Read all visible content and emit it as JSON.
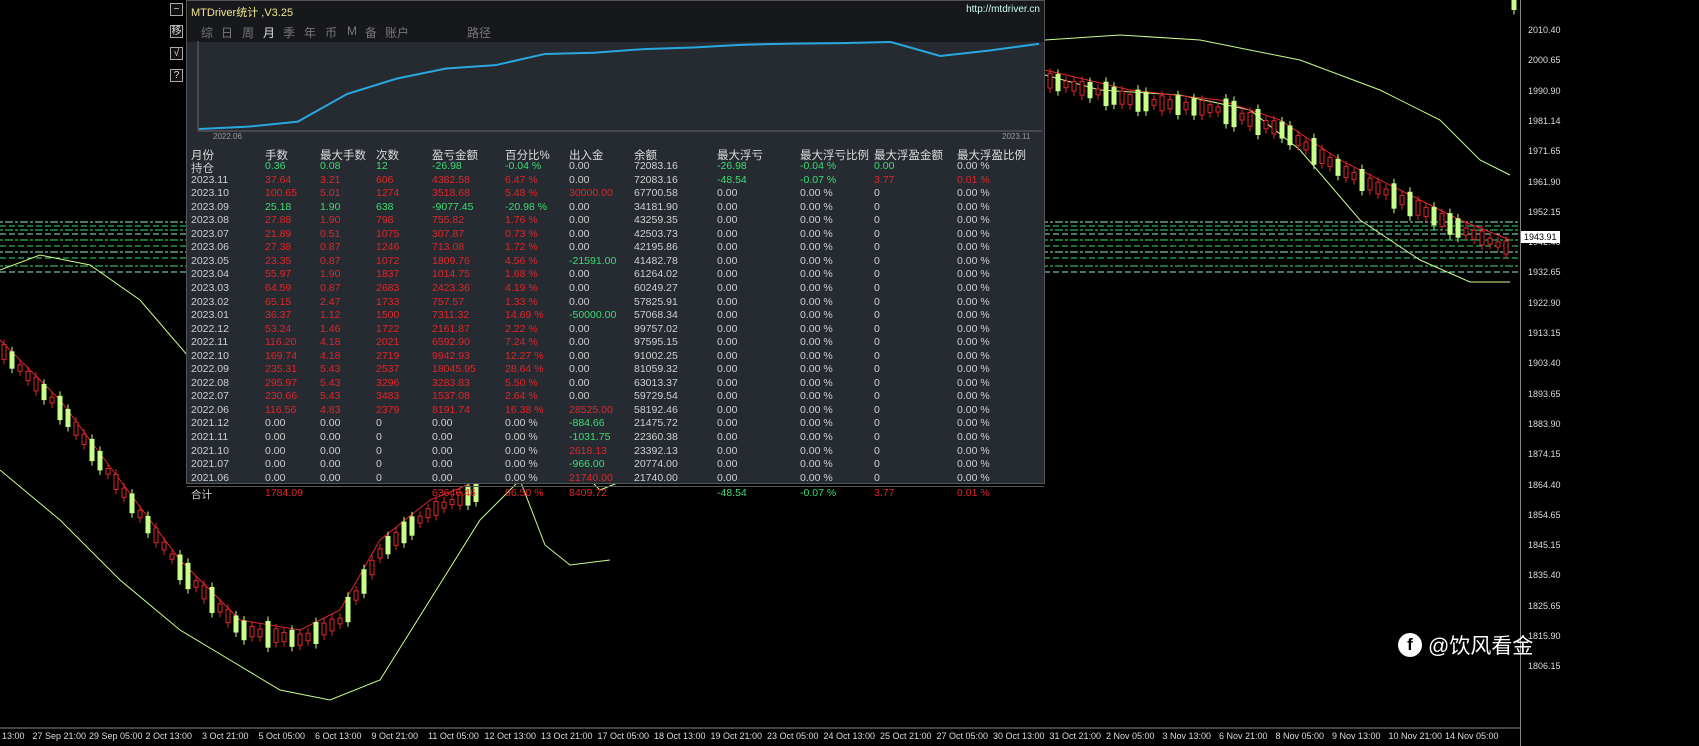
{
  "window": {
    "title": "MTDriver统计 ,V3.25",
    "url": "http://mtdriver.cn"
  },
  "side_buttons": [
    "−",
    "移",
    "√",
    "?"
  ],
  "tabs": [
    {
      "label": "综"
    },
    {
      "label": "日"
    },
    {
      "label": "周"
    },
    {
      "label": "月",
      "active": true
    },
    {
      "label": "季"
    },
    {
      "label": "年"
    },
    {
      "label": "币"
    },
    {
      "label": "M"
    },
    {
      "label": "备"
    },
    {
      "label": "账户"
    },
    {
      "label": "路径"
    }
  ],
  "chart_data": {
    "type": "line",
    "title": "",
    "x_start_label": "2022.06",
    "x_end_label": "2023.11",
    "series": [
      {
        "name": "equity",
        "color": "#29a8e0",
        "values": [
          8191.74,
          9728.82,
          13012.65,
          31058.6,
          41001.53,
          47594.43,
          49756.3,
          57067.62,
          57825.19,
          60248.55,
          61263.3,
          63073.06,
          63786.14,
          64094.01,
          64849.83,
          55772.38,
          59291.06,
          63673.64
        ]
      }
    ]
  },
  "table": {
    "headers": [
      "月份",
      "手数",
      "最大手数",
      "次数",
      "盈亏金额",
      "百分比%",
      "出入金",
      "余额",
      "最大浮亏",
      "最大浮亏比例",
      "最大浮盈金额",
      "最大浮盈比例"
    ],
    "rows": [
      {
        "c": "wgggggwwgggw",
        "v": [
          "持仓",
          "0.36",
          "0.08",
          "12",
          "-26.98",
          "-0.04 %",
          "0.00",
          "72083.16",
          "-26.98",
          "-0.04 %",
          "0.00",
          "0.00 %"
        ]
      },
      {
        "c": "wrrrrrwwggrr",
        "v": [
          "2023.11",
          "37.64",
          "3.21",
          "606",
          "4382.58",
          "6.47 %",
          "0.00",
          "72083.16",
          "-48.54",
          "-0.07 %",
          "3.77",
          "0.01 %"
        ]
      },
      {
        "c": "wrrrrrrwwwww",
        "v": [
          "2023.10",
          "100.65",
          "5.01",
          "1274",
          "3518.68",
          "5.48 %",
          "30000.00",
          "67700.58",
          "0.00",
          "0.00 %",
          "0",
          "0.00 %"
        ]
      },
      {
        "c": "wgggggwwwwww",
        "v": [
          "2023.09",
          "25.18",
          "1.90",
          "638",
          "-9077.45",
          "-20.98 %",
          "0.00",
          "34181.90",
          "0.00",
          "0.00 %",
          "0",
          "0.00 %"
        ]
      },
      {
        "c": "wrrrrrwwwwww",
        "v": [
          "2023.08",
          "27.88",
          "1.90",
          "798",
          "755.82",
          "1.76 %",
          "0.00",
          "43259.35",
          "0.00",
          "0.00 %",
          "0",
          "0.00 %"
        ]
      },
      {
        "c": "wrrrrrwwwwww",
        "v": [
          "2023.07",
          "21.89",
          "0.51",
          "1075",
          "307.87",
          "0.73 %",
          "0.00",
          "42503.73",
          "0.00",
          "0.00 %",
          "0",
          "0.00 %"
        ]
      },
      {
        "c": "wrrrrrwwwwww",
        "v": [
          "2023.06",
          "27.38",
          "0.87",
          "1246",
          "713.08",
          "1.72 %",
          "0.00",
          "42195.86",
          "0.00",
          "0.00 %",
          "0",
          "0.00 %"
        ]
      },
      {
        "c": "wrrrrrgwwwww",
        "v": [
          "2023.05",
          "23.35",
          "0.87",
          "1072",
          "1809.76",
          "4.56 %",
          "-21591.00",
          "41482.78",
          "0.00",
          "0.00 %",
          "0",
          "0.00 %"
        ]
      },
      {
        "c": "wrrrrrwwwwww",
        "v": [
          "2023.04",
          "55.97",
          "1.90",
          "1837",
          "1014.75",
          "1.68 %",
          "0.00",
          "61264.02",
          "0.00",
          "0.00 %",
          "0",
          "0.00 %"
        ]
      },
      {
        "c": "wrrrrrwwwwww",
        "v": [
          "2023.03",
          "64.59",
          "0.87",
          "2683",
          "2423.36",
          "4.19 %",
          "0.00",
          "60249.27",
          "0.00",
          "0.00 %",
          "0",
          "0.00 %"
        ]
      },
      {
        "c": "wrrrrrwwwwww",
        "v": [
          "2023.02",
          "65.15",
          "2.47",
          "1733",
          "757.57",
          "1.33 %",
          "0.00",
          "57825.91",
          "0.00",
          "0.00 %",
          "0",
          "0.00 %"
        ]
      },
      {
        "c": "wrrrrrgwwwww",
        "v": [
          "2023.01",
          "36.37",
          "1.12",
          "1500",
          "7311.32",
          "14.69 %",
          "-50000.00",
          "57068.34",
          "0.00",
          "0.00 %",
          "0",
          "0.00 %"
        ]
      },
      {
        "c": "wrrrrrwwwwww",
        "v": [
          "2022.12",
          "53.24",
          "1.46",
          "1722",
          "2161.87",
          "2.22 %",
          "0.00",
          "99757.02",
          "0.00",
          "0.00 %",
          "0",
          "0.00 %"
        ]
      },
      {
        "c": "wrrrrrwwwwww",
        "v": [
          "2022.11",
          "116.20",
          "4.18",
          "2021",
          "6592.90",
          "7.24 %",
          "0.00",
          "97595.15",
          "0.00",
          "0.00 %",
          "0",
          "0.00 %"
        ]
      },
      {
        "c": "wrrrrrwwwwww",
        "v": [
          "2022.10",
          "169.74",
          "4.18",
          "2719",
          "9942.93",
          "12.27 %",
          "0.00",
          "91002.25",
          "0.00",
          "0.00 %",
          "0",
          "0.00 %"
        ]
      },
      {
        "c": "wrrrrrwwwwww",
        "v": [
          "2022.09",
          "235.31",
          "5.43",
          "2537",
          "18045.95",
          "28.64 %",
          "0.00",
          "81059.32",
          "0.00",
          "0.00 %",
          "0",
          "0.00 %"
        ]
      },
      {
        "c": "wrrrrrwwwwww",
        "v": [
          "2022.08",
          "295.97",
          "5.43",
          "3296",
          "3283.83",
          "5.50 %",
          "0.00",
          "63013.37",
          "0.00",
          "0.00 %",
          "0",
          "0.00 %"
        ]
      },
      {
        "c": "wrrrrrwwwwww",
        "v": [
          "2022.07",
          "230.66",
          "5.43",
          "3483",
          "1537.08",
          "2.64 %",
          "0.00",
          "59729.54",
          "0.00",
          "0.00 %",
          "0",
          "0.00 %"
        ]
      },
      {
        "c": "wrrrrrrwwwww",
        "v": [
          "2022.06",
          "116.56",
          "4.83",
          "2379",
          "8191.74",
          "16.38 %",
          "28525.00",
          "58192.46",
          "0.00",
          "0.00 %",
          "0",
          "0.00 %"
        ]
      },
      {
        "c": "wwwwwwgwwwww",
        "v": [
          "2021.12",
          "0.00",
          "0.00",
          "0",
          "0.00",
          "0.00 %",
          "-884.66",
          "21475.72",
          "0.00",
          "0.00 %",
          "0",
          "0.00 %"
        ]
      },
      {
        "c": "wwwwwwgwwwww",
        "v": [
          "2021.11",
          "0.00",
          "0.00",
          "0",
          "0.00",
          "0.00 %",
          "-1031.75",
          "22360.38",
          "0.00",
          "0.00 %",
          "0",
          "0.00 %"
        ]
      },
      {
        "c": "wwwwwwrwwwww",
        "v": [
          "2021.10",
          "0.00",
          "0.00",
          "0",
          "0.00",
          "0.00 %",
          "2618.13",
          "23392.13",
          "0.00",
          "0.00 %",
          "0",
          "0.00 %"
        ]
      },
      {
        "c": "wwwwwwgwwwww",
        "v": [
          "2021.07",
          "0.00",
          "0.00",
          "0",
          "0.00",
          "0.00 %",
          "-966.00",
          "20774.00",
          "0.00",
          "0.00 %",
          "0",
          "0.00 %"
        ]
      },
      {
        "c": "wwwwwwrwwwww",
        "v": [
          "2021.06",
          "0.00",
          "0.00",
          "0",
          "0.00",
          "0.00 %",
          "21740.00",
          "21740.00",
          "0.00",
          "0.00 %",
          "0",
          "0.00 %"
        ]
      },
      {
        "c": "wrwwrrrwggrr",
        "v": [
          "合计",
          "1784.09",
          "",
          "",
          "63646.46",
          "96.50 %",
          "8409.72",
          "",
          "-48.54",
          "-0.07 %",
          "3.77",
          "0.01 %"
        ]
      }
    ]
  },
  "price_axis": [
    "2010.40",
    "2000.65",
    "1990.90",
    "1981.14",
    "1971.65",
    "1961.90",
    "1952.15",
    "1942.40",
    "1932.65",
    "1922.90",
    "1913.15",
    "1903.40",
    "1893.65",
    "1883.90",
    "1874.15",
    "1864.40",
    "1854.65",
    "1845.15",
    "1835.40",
    "1825.65",
    "1815.90",
    "1806.15"
  ],
  "current_price": "1943.91",
  "time_axis": [
    "13:00",
    "27 Sep 21:00",
    "29 Sep 05:00",
    "2 Oct 13:00",
    "3 Oct 21:00",
    "5 Oct 05:00",
    "6 Oct 13:00",
    "9 Oct 21:00",
    "11 Oct 05:00",
    "12 Oct 13:00",
    "13 Oct 21:00",
    "17 Oct 05:00",
    "18 Oct 13:00",
    "19 Oct 21:00",
    "23 Oct 05:00",
    "24 Oct 13:00",
    "25 Oct 21:00",
    "27 Oct 05:00",
    "30 Oct 13:00",
    "31 Oct 21:00",
    "2 Nov 05:00",
    "3 Nov 13:00",
    "6 Nov 21:00",
    "8 Nov 05:00",
    "9 Nov 13:00",
    "10 Nov 21:00",
    "14 Nov 05:00"
  ],
  "watermark": {
    "icon": "f",
    "text": "@饮风看金"
  }
}
